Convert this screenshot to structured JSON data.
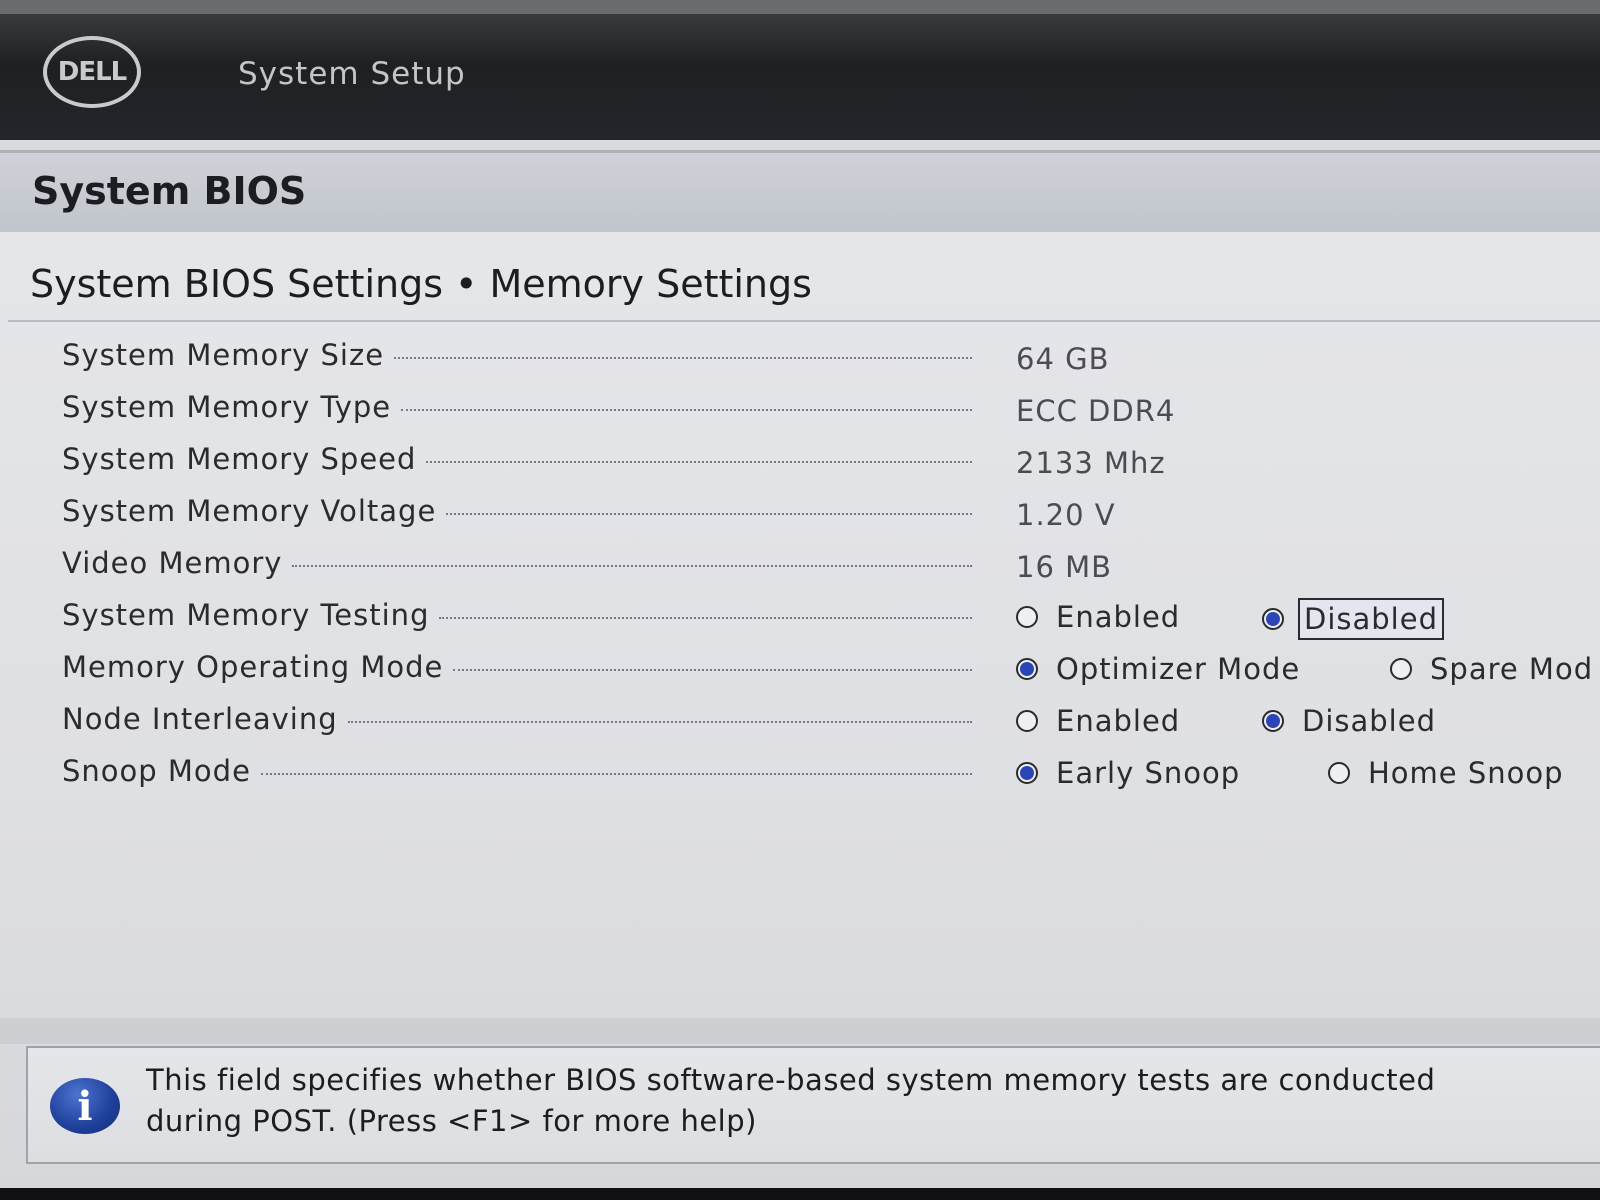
{
  "header": {
    "logo_text": "DELL",
    "app_title": "System Setup"
  },
  "panel": {
    "title": "System BIOS",
    "breadcrumb": {
      "parent": "System BIOS Settings",
      "separator": "•",
      "current": "Memory Settings"
    }
  },
  "settings": {
    "memory_size": {
      "label": "System Memory Size",
      "value": "64 GB"
    },
    "memory_type": {
      "label": "System Memory Type",
      "value": "ECC DDR4"
    },
    "memory_speed": {
      "label": "System Memory Speed",
      "value": "2133 Mhz"
    },
    "memory_voltage": {
      "label": "System Memory Voltage",
      "value": "1.20 V"
    },
    "video_memory": {
      "label": "Video Memory",
      "value": "16 MB"
    },
    "memory_testing": {
      "label": "System Memory Testing",
      "options": [
        "Enabled",
        "Disabled"
      ],
      "selected": "Disabled"
    },
    "operating_mode": {
      "label": "Memory Operating Mode",
      "options": [
        "Optimizer Mode",
        "Spare Mod"
      ],
      "selected": "Optimizer Mode"
    },
    "node_interleaving": {
      "label": "Node Interleaving",
      "options": [
        "Enabled",
        "Disabled"
      ],
      "selected": "Disabled"
    },
    "snoop_mode": {
      "label": "Snoop Mode",
      "options": [
        "Early Snoop",
        "Home Snoop"
      ],
      "selected": "Early Snoop"
    }
  },
  "help": {
    "icon": "info-icon",
    "icon_glyph": "i",
    "line1": "This field specifies whether BIOS software-based system memory tests are conducted",
    "line2": "during POST. (Press <F1> for more help)"
  },
  "colors": {
    "header_bg": "#1f2023",
    "title_bar_bg": "#c1c5cc",
    "radio_selected": "#2c46b8",
    "info_icon": "#1e3f9a"
  }
}
